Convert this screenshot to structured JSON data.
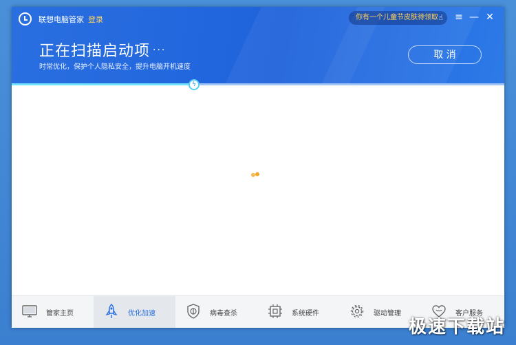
{
  "window": {
    "app_title": "联想电脑管家",
    "login_label": "登录",
    "promo_text": "你有一个儿童节皮肤待领取",
    "menu_icon": "menu-icon",
    "minimize_icon": "minimize-icon",
    "close_icon": "close-icon"
  },
  "scan": {
    "heading": "正在扫描启动项",
    "heading_dots": "···",
    "subtitle": "时常优化，保护个人隐私安全，提升电脑开机速度",
    "cancel_label": "取 消",
    "progress_percent": 37
  },
  "nav": {
    "items": [
      {
        "label": "管家主页",
        "icon": "monitor-icon",
        "active": false
      },
      {
        "label": "优化加速",
        "icon": "rocket-icon",
        "active": true
      },
      {
        "label": "病毒查杀",
        "icon": "shield-icon",
        "active": false
      },
      {
        "label": "系统硬件",
        "icon": "chip-icon",
        "active": false
      },
      {
        "label": "驱动管理",
        "icon": "gear-icon",
        "active": false
      },
      {
        "label": "客户服务",
        "icon": "heart-icon",
        "active": false
      }
    ]
  },
  "watermark": "极速下载站",
  "colors": {
    "header_blue": "#1f63dc",
    "accent_yellow": "#ffd35c",
    "spinner_orange": "#f0a92b",
    "progress_cyan": "#6fe3ff"
  }
}
